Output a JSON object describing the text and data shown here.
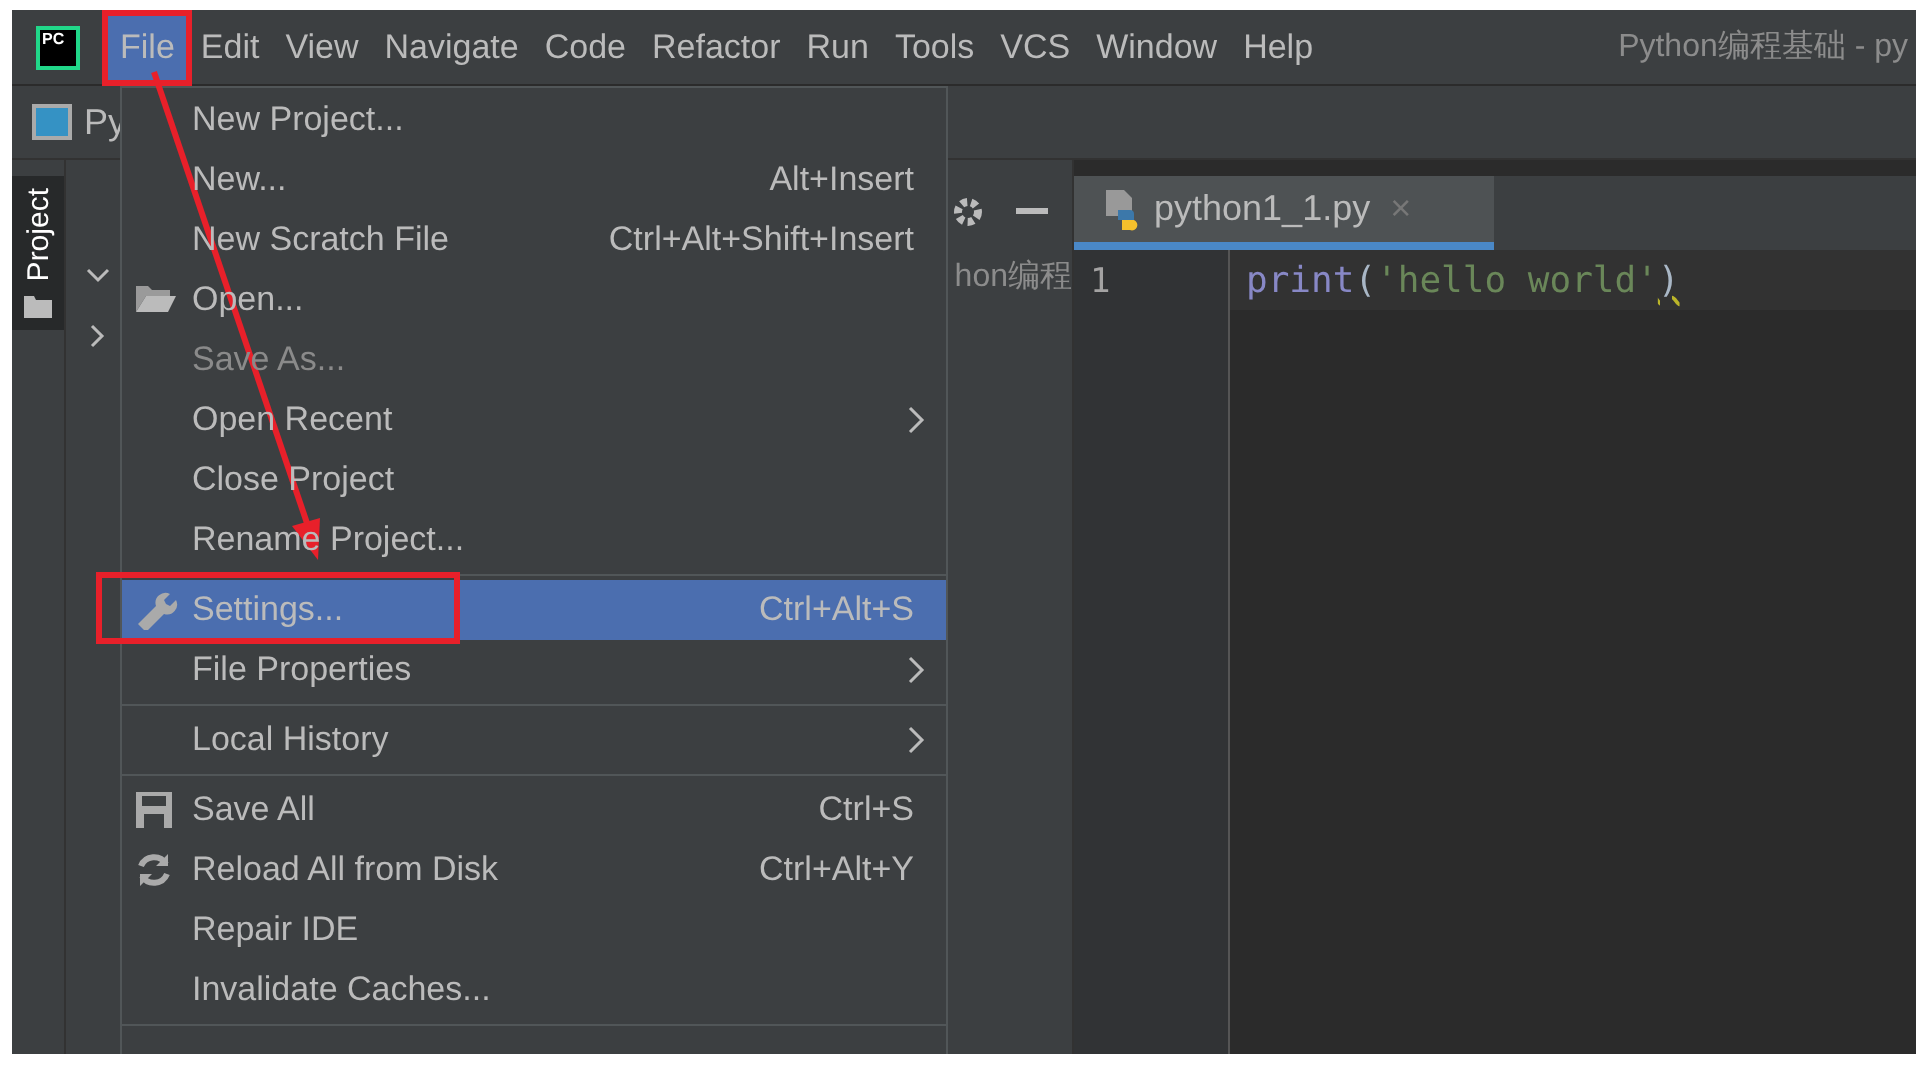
{
  "window": {
    "logo": "PC",
    "title": "Python编程基础 - py"
  },
  "menubar": [
    {
      "label": "File",
      "selected": true,
      "highlighted": true
    },
    {
      "label": "Edit",
      "selected": false,
      "highlighted": false
    },
    {
      "label": "View",
      "selected": false,
      "highlighted": false
    },
    {
      "label": "Navigate",
      "selected": false,
      "highlighted": false
    },
    {
      "label": "Code",
      "selected": false,
      "highlighted": false
    },
    {
      "label": "Refactor",
      "selected": false,
      "highlighted": false
    },
    {
      "label": "Run",
      "selected": false,
      "highlighted": false
    },
    {
      "label": "Tools",
      "selected": false,
      "highlighted": false
    },
    {
      "label": "VCS",
      "selected": false,
      "highlighted": false
    },
    {
      "label": "Window",
      "selected": false,
      "highlighted": false
    },
    {
      "label": "Help",
      "selected": false,
      "highlighted": false
    }
  ],
  "navbar": {
    "project": "Py"
  },
  "tool_strip": [
    {
      "label": "Project",
      "selected": true
    }
  ],
  "project_panel": {
    "rows": [
      {
        "expanded": true,
        "label": "hon编程"
      },
      {
        "expanded": false
      }
    ]
  },
  "editor": {
    "tabs": [
      {
        "label": "python1_1.py",
        "close": "×",
        "selected": true
      }
    ],
    "lines": [
      {
        "number": "1",
        "tokens": [
          {
            "kind": "function",
            "text": "print"
          },
          {
            "kind": "paren",
            "text": "("
          },
          {
            "kind": "string",
            "text": "'hello world'"
          },
          {
            "kind": "paren",
            "text": ")",
            "warning": true
          }
        ]
      }
    ]
  },
  "file_menu": {
    "groups": [
      [
        {
          "label": "New Project...",
          "selected": false,
          "disabled": false,
          "submenu": false,
          "highlighted": false
        },
        {
          "label": "New...",
          "shortcut": "Alt+Insert",
          "selected": false,
          "disabled": false,
          "submenu": false,
          "highlighted": false
        },
        {
          "label": "New Scratch File",
          "shortcut": "Ctrl+Alt+Shift+Insert",
          "selected": false,
          "disabled": false,
          "submenu": false,
          "highlighted": false
        },
        {
          "label": "Open...",
          "selected": false,
          "disabled": false,
          "submenu": false,
          "highlighted": false
        },
        {
          "label": "Save As...",
          "selected": false,
          "disabled": true,
          "submenu": false,
          "highlighted": false
        },
        {
          "label": "Open Recent",
          "selected": false,
          "disabled": false,
          "submenu": true,
          "highlighted": false
        },
        {
          "label": "Close Project",
          "selected": false,
          "disabled": false,
          "submenu": false,
          "highlighted": false
        },
        {
          "label": "Rename Project...",
          "selected": false,
          "disabled": false,
          "submenu": false,
          "highlighted": false
        }
      ],
      [
        {
          "label": "Settings...",
          "shortcut": "Ctrl+Alt+S",
          "selected": true,
          "disabled": false,
          "submenu": false,
          "highlighted": true
        },
        {
          "label": "File Properties",
          "selected": false,
          "disabled": false,
          "submenu": true,
          "highlighted": false
        }
      ],
      [
        {
          "label": "Local History",
          "selected": false,
          "disabled": false,
          "submenu": true,
          "highlighted": false
        }
      ],
      [
        {
          "label": "Save All",
          "shortcut": "Ctrl+S",
          "selected": false,
          "disabled": false,
          "submenu": false,
          "highlighted": false
        },
        {
          "label": "Reload All from Disk",
          "shortcut": "Ctrl+Alt+Y",
          "selected": false,
          "disabled": false,
          "submenu": false,
          "highlighted": false
        },
        {
          "label": "Repair IDE",
          "selected": false,
          "disabled": false,
          "submenu": false,
          "highlighted": false
        },
        {
          "label": "Invalidate Caches...",
          "selected": false,
          "disabled": false,
          "submenu": false,
          "highlighted": false
        }
      ]
    ]
  }
}
